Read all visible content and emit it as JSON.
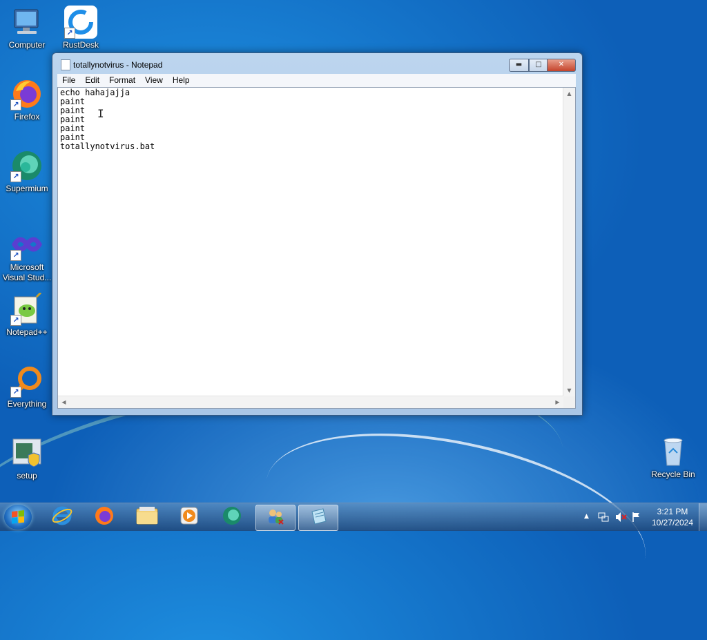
{
  "desktop": {
    "icons": [
      {
        "label": "Computer"
      },
      {
        "label": "RustDesk"
      },
      {
        "label": "Firefox"
      },
      {
        "label": "Supermium"
      },
      {
        "label": "Microsoft Visual Stud..."
      },
      {
        "label": "Notepad++"
      },
      {
        "label": "Everything"
      },
      {
        "label": "setup"
      },
      {
        "label": "Recycle Bin"
      }
    ]
  },
  "window": {
    "title": "totallynotvirus - Notepad",
    "buttons": {
      "minimize": "▬",
      "maximize": "□",
      "close": "✕"
    },
    "menu": [
      "File",
      "Edit",
      "Format",
      "View",
      "Help"
    ],
    "content": "echo hahajajja\npaint\npaint\npaint\npaint\npaint\ntotallynotvirus.bat"
  },
  "taskbar": {
    "items": [
      {
        "icon": "internet-explorer-icon"
      },
      {
        "icon": "firefox-icon"
      },
      {
        "icon": "file-explorer-icon"
      },
      {
        "icon": "media-player-icon"
      },
      {
        "icon": "supermium-icon"
      },
      {
        "icon": "users-icon"
      },
      {
        "icon": "notepad-icon"
      }
    ],
    "clock": {
      "time": "3:21 PM",
      "date": "10/27/2024"
    },
    "tray": {
      "chevron": "▲"
    }
  },
  "colors": {
    "desktop_blue": "#0d5fb8",
    "close_red": "#c4432b"
  }
}
